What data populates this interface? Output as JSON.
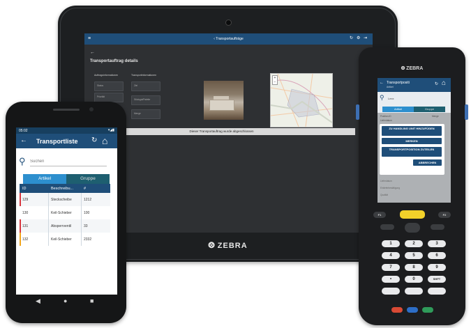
{
  "tablet": {
    "app_title": "Transportaufträge",
    "back_icon": "arrow-left-icon",
    "page_title": "Transportauftrag details",
    "col1_label": "Auftragsinformationen",
    "col2_label": "Transportinformationen",
    "field_1": "Status",
    "field_1_value": "offen",
    "field_2": "Priorität",
    "field_2_value": "Stückgut/Palette",
    "field_3": "Artikel",
    "field_3_value": "Lager",
    "field_4": "Ziel",
    "field_5": "Menge",
    "status_bar": "Dieser Transportauftrag wurde abgeschlossen",
    "brand": "ZEBRA"
  },
  "phone": {
    "time": "05:02",
    "status_icons": "▾◢▮",
    "title": "Transportliste",
    "search_placeholder": "Suchen",
    "tabs": [
      "Artikel",
      "Gruppe"
    ],
    "columns": [
      "ID",
      "Beschreibu...",
      "#"
    ],
    "rows": [
      {
        "id": "129",
        "desc": "Steckscheibe",
        "qty": "1212",
        "flag": "#d9363e"
      },
      {
        "id": "130",
        "desc": "Keil-Schieber",
        "qty": "100",
        "flag": ""
      },
      {
        "id": "131",
        "desc": "Absperrventil",
        "qty": "33",
        "flag": "#d9363e"
      },
      {
        "id": "132",
        "desc": "Keil-Schieber",
        "qty": "2332",
        "flag": "#f2a51a"
      }
    ],
    "nav": [
      "◀",
      "●",
      "■"
    ]
  },
  "scanner": {
    "brand": "ZEBRA",
    "title": "Transportpositi",
    "subtitle": "Artikel",
    "search_value": "Lexx",
    "tabs": [
      "Artikel",
      "Gruppe"
    ],
    "bg_1": "Position-ID",
    "bg_1b": "Menge",
    "bg_2": "Lieferdatum",
    "bg_3": "Lieferdatum",
    "bg_4": "Einlieferbestätigung",
    "bg_5": "Qualität",
    "dialog_buttons": [
      "ZU HANDLING UNIT HINZUFÜGEN",
      "MERKEN",
      "TRANSPORTPOSITION ZUTEILEN",
      "ABBRECHEN"
    ],
    "keys": {
      "f1": "F1",
      "f2": "F2",
      "k1": "1",
      "k2": "2",
      "k3": "3",
      "k4": "4",
      "k5": "5",
      "k6": "6",
      "k7": "7",
      "k8": "8",
      "k9": "9",
      "kdot": "•",
      "k0": "0",
      "kshift": "SHFT"
    }
  },
  "colors": {
    "primary": "#1f4e79",
    "tab_active": "#2d8fce",
    "tab_inactive": "#1e5f70",
    "flag_red": "#d9363e",
    "flag_orange": "#f2a51a"
  }
}
